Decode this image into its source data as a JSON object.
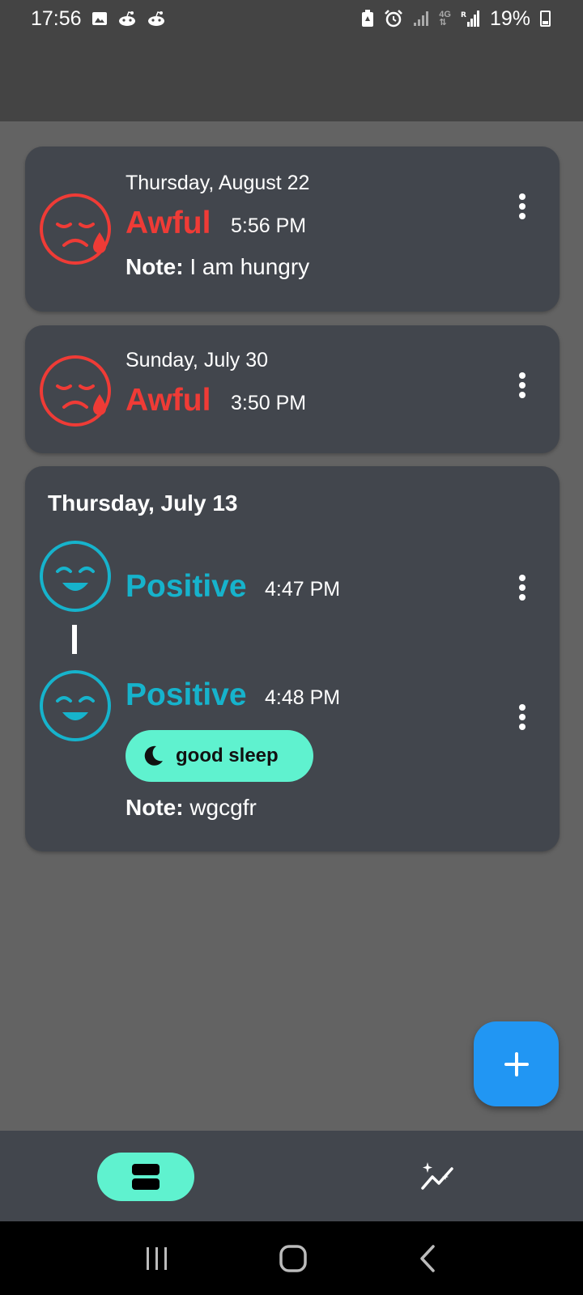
{
  "status_bar": {
    "time": "17:56",
    "battery": "19%",
    "icons": [
      "image-icon",
      "reddit-icon",
      "reddit-icon",
      "battery-saver-icon",
      "alarm-icon",
      "signal-icon",
      "4g-icon",
      "signal-r-icon",
      "battery-icon"
    ]
  },
  "entries": [
    {
      "date": "Thursday, August 22",
      "mood": "Awful",
      "time": "5:56 PM",
      "note_label": "Note:",
      "note": "I am hungry",
      "icon": "sad-tear-face-icon"
    },
    {
      "date": "Sunday, July 30",
      "mood": "Awful",
      "time": "3:50 PM",
      "icon": "sad-tear-face-icon"
    }
  ],
  "group": {
    "date": "Thursday, July 13",
    "items": [
      {
        "mood": "Positive",
        "time": "4:47 PM",
        "icon": "smiling-face-icon"
      },
      {
        "mood": "Positive",
        "time": "4:48 PM",
        "icon": "smiling-face-icon",
        "tag": "good sleep",
        "tag_icon": "moon-icon",
        "note_label": "Note:",
        "note": "wgcgfr"
      }
    ]
  },
  "colors": {
    "awful": "#ef3b36",
    "positive": "#16b3cc",
    "accent": "#5ff2cf",
    "fab": "#2196f3",
    "card": "#42464d",
    "background": "#636363"
  },
  "fab": {
    "icon": "plus-icon"
  },
  "bottom_nav": {
    "items": [
      {
        "icon": "entries-list-icon",
        "selected": true
      },
      {
        "icon": "insights-sparkle-chart-icon",
        "selected": false
      }
    ]
  },
  "system_nav": [
    "recents-icon",
    "home-icon",
    "back-icon"
  ]
}
